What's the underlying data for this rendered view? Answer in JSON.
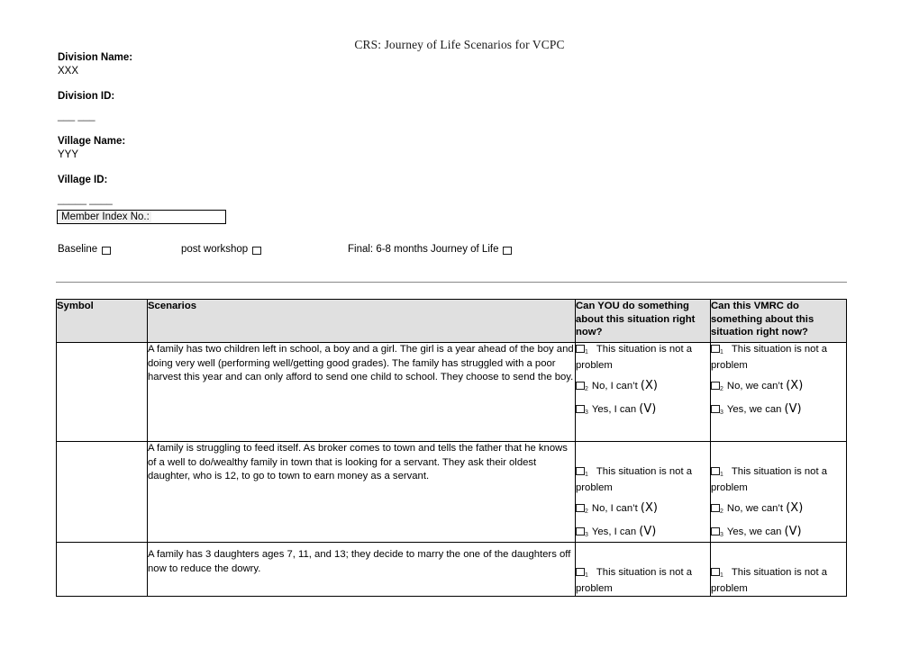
{
  "document": {
    "title": "CRS: Journey of Life Scenarios for VCPC"
  },
  "meta": {
    "division_name_label": "Division Name:",
    "division_name_value": "XXX",
    "division_id_label": "Division ID:",
    "division_id_rule": "___ ___",
    "village_name_label": "Village Name:",
    "village_name_value": "YYY",
    "village_id_label": "Village ID:",
    "village_id_rule": "_____ ____",
    "member_index_label": "Member Index No.:",
    "member_index_value": ""
  },
  "stages": [
    {
      "label": "Baseline",
      "checked": false
    },
    {
      "label": "post workshop",
      "checked": false
    },
    {
      "label": "Final: 6-8 months Journey of Life",
      "checked": false
    }
  ],
  "table": {
    "headers": [
      "Symbol",
      "Scenarios",
      "Can YOU do something about this situation right now?",
      "Can this VMRC do something about this situation right now?"
    ],
    "you_options": [
      {
        "num": "1",
        "text": "This situation is not a problem"
      },
      {
        "num": "2",
        "text": "No, I can’t",
        "mark": "(X)"
      },
      {
        "num": "3",
        "text": "Yes, I can",
        "mark": "(V)"
      }
    ],
    "vmrc_options": [
      {
        "num": "1",
        "text": "This situation is not a problem"
      },
      {
        "num": "2",
        "text": "No, we can’t",
        "mark": "(X)"
      },
      {
        "num": "3",
        "text": "Yes, we can",
        "mark": "(V)"
      }
    ],
    "rows": [
      {
        "symbol": "",
        "scenario": "A family has two children left in school, a boy and a girl.  The girl is a year ahead of the boy and doing very well (performing well/getting good grades). The family has struggled with a poor harvest this year and can only afford to send one child to school.  They choose to send the boy."
      },
      {
        "symbol": "",
        "scenario": "A family is struggling to feed itself.  As broker comes to town and tells the father that he knows of a well to do/wealthy family in town that is looking for a servant.  They ask their oldest daughter, who is 12, to go to town to earn money as a servant."
      },
      {
        "symbol": "",
        "scenario": "A family has 3 daughters ages 7, 11, and 13; they decide to marry the one of the daughters off now to reduce the dowry."
      }
    ]
  },
  "colors": {
    "header_fill": "#e0e0e0",
    "border": "#000000",
    "rule": "#888888",
    "member_box_fill": "#f2f2f2"
  }
}
